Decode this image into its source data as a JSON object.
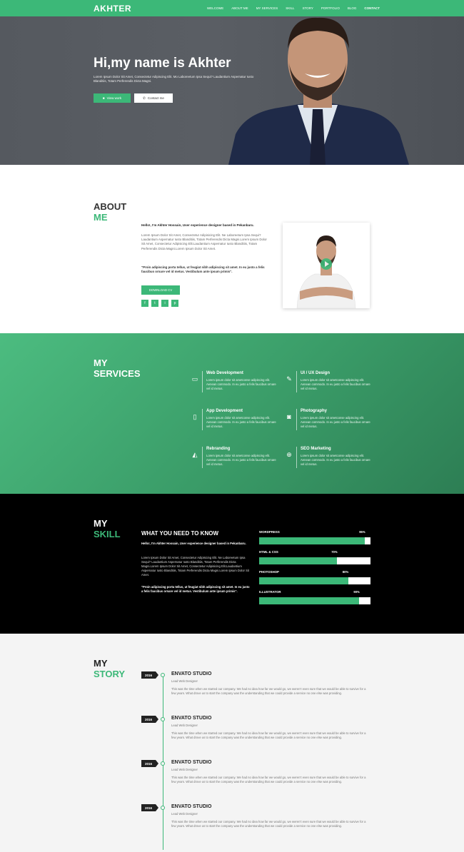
{
  "nav": {
    "logo": "AKHTER",
    "items": [
      "WELCOME",
      "ABOUT ME",
      "MY SERVICES",
      "SKILL",
      "STORY",
      "PORTFOLIO",
      "BLOG",
      "CONTACT"
    ],
    "active": "CONTACT"
  },
  "hero": {
    "title": "Hi,my name is Akhter",
    "text": "Lorem Ipsum Dolor Sit Amet, Consectetur Adipiscing Elit. Mo Laboreetum Ipsa Sequi? Laudantium Aspernatur Iusto Blanditiis, Totam Perferendis Dicta Magni.",
    "btn_primary": "View work",
    "btn_secondary": "Contact me"
  },
  "about": {
    "title_1": "ABOUT",
    "title_2": "ME",
    "heading": "Hello!, I'm Akhter Hossain, User experience designer based in Pekanbaru.",
    "p1": "Lorem Ipsum Dolor Sit Amet, Consectetur Adipisicing Elit. Ne Laboreetum Ipsa Sequi? Laudantium Aspernatur Iusto Blanditiis, Totam Perferendis Dicta Magni.Lorem Ipsum Dolor Sit Amet, Consectetur Adipisicing Elit.Laudantium Aspernatur Iusto Blanditiis, Totam Perferendis Dicta Magni.Lorem Ipsum Dolor Sit Amet.",
    "p2": "\"Proin adipiscing porta tellus, ut feugiat nibh adipiscing sit amet. In eu justo a felis faucibus ornare vel id metus. Vestibulum ante ipsum primis\".",
    "download": "DOWNLOAD CV",
    "socials": [
      "f",
      "t",
      "i",
      "p"
    ]
  },
  "services": {
    "title_1": "MY",
    "title_2": "SERVICES",
    "items": [
      {
        "title": "Web Development",
        "desc": "Lorem ipsum dolor sit ametconse adipiscing elit. Aenean commodo. In eu justo a felis faucibus ornare vel id metus.",
        "icon": "laptop-icon",
        "glyph": "▭"
      },
      {
        "title": "UI / UX Design",
        "desc": "Lorem ipsum dolor sit ametconse adipiscing elit. Aenean commodo. In eu justo a felis faucibus ornare vel id metus.",
        "icon": "pencil-icon",
        "glyph": "✎"
      },
      {
        "title": "App Development",
        "desc": "Lorem ipsum dolor sit ametconse adipiscing elit. Aenean commodo. In eu justo a felis faucibus ornare vel id metus.",
        "icon": "mobile-icon",
        "glyph": "▯"
      },
      {
        "title": "Photography",
        "desc": "Lorem ipsum dolor sit ametconse adipiscing elit. Aenean commodo. In eu justo a felis faucibus ornare vel id metus.",
        "icon": "camera-icon",
        "glyph": "◙"
      },
      {
        "title": "Rebranding",
        "desc": "Lorem ipsum dolor sit ametconse adipiscing elit. Aenean commodo. In eu justo a felis faucibus ornare vel id metus.",
        "icon": "paper-plane-icon",
        "glyph": "◭"
      },
      {
        "title": "SEO Marketing",
        "desc": "Lorem ipsum dolor sit ametconse adipiscing elit. Aenean commodo. In eu justo a felis faucibus ornare vel id metus.",
        "icon": "globe-icon",
        "glyph": "⊕"
      }
    ]
  },
  "skill": {
    "title_1": "MY",
    "title_2": "SKILL",
    "heading": "WHAT YOU NEED TO KNOW",
    "p1": "Hello!, I'm Akhter Hossain, User experience designer based in Pekanbaru.",
    "p2": "Lorem Ipsum Dolor Sit Amet, Consectetur Adipisicing Elit. Ne Laboreetum Ipsa Sequi? Laudantium Aspernatur Iusto Blanditiis, Totam Perferendis Dicta Magni.Lorem Ipsum Dolor Sit Amet, Consectetur Adipisicing Elit.Laudantium Aspernatur Iusto Blanditiis, Totam Perferendis Dicta Magni.Lorem Ipsum Dolor Sit Amet.",
    "p3": "\"Proin adipiscing porta tellus, ut feugiat nibh adipiscing sit amet. In eu justo a felis faucibus ornare vel id metus. Vestibulum ante ipsum primis\".",
    "bars": [
      {
        "name": "WORDPRESS",
        "percent": 95,
        "label": "95%"
      },
      {
        "name": "HTML & CSS",
        "percent": 70,
        "label": "70%"
      },
      {
        "name": "PHOTOSHOP",
        "percent": 80,
        "label": "80%"
      },
      {
        "name": "ILLUSTRATOR",
        "percent": 90,
        "label": "90%"
      }
    ]
  },
  "story": {
    "title_1": "MY",
    "title_2": "STORY",
    "items": [
      {
        "year": "2016",
        "title": "ENVATO STUDIO",
        "sub": "Lead Web Designer",
        "desc": "This was the time when we started our company. We had no idea how far we would go, we weren’t even sure that we would be able to survive for a few years. What drove us to start the company was the understanding that we could provide a service no one else was providing."
      },
      {
        "year": "2016",
        "title": "ENVATO STUDIO",
        "sub": "Lead Web Designer",
        "desc": "This was the time when we started our company. We had no idea how far we would go, we weren’t even sure that we would be able to survive for a few years. What drove us to start the company was the understanding that we could provide a service no one else was providing."
      },
      {
        "year": "2016",
        "title": "ENVATO STUDIO",
        "sub": "Lead Web Designer",
        "desc": "This was the time when we started our company. We had no idea how far we would go, we weren’t even sure that we would be able to survive for a few years. What drove us to start the company was the understanding that we could provide a service no one else was providing."
      },
      {
        "year": "2016",
        "title": "ENVATO STUDIO",
        "sub": "Lead Web Designer",
        "desc": "This was the time when we started our company. We had no idea how far we would go, we weren’t even sure that we would be able to survive for a few years. What drove us to start the company was the understanding that we could provide a service no one else was providing."
      }
    ]
  },
  "colors": {
    "accent": "#3cb878",
    "dark": "#000000",
    "light_bg": "#f4f4f4"
  }
}
